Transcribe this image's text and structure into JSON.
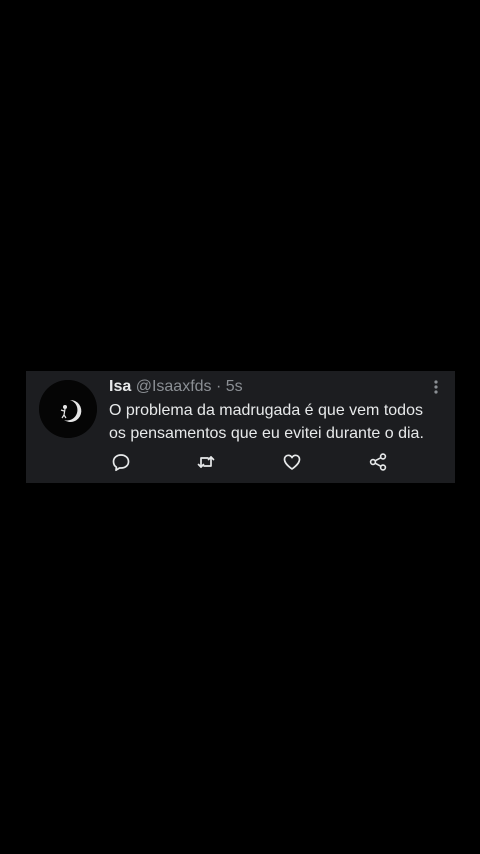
{
  "tweet": {
    "author_name": "Isa",
    "handle": "@Isaaxfds",
    "separator": "·",
    "time": "5s",
    "text_lines": [
      "O problema da madrugada é que vem todos",
      "os pensamentos que eu evitei durante o dia."
    ],
    "actions": [
      "reply-icon",
      "retweet-icon",
      "like-icon",
      "share-icon"
    ],
    "more_icon": "more-vertical-icon"
  },
  "colors": {
    "background": "#000000",
    "card": "#1c1d20",
    "text": "#e7e9ea",
    "secondary": "#8b8f94"
  }
}
